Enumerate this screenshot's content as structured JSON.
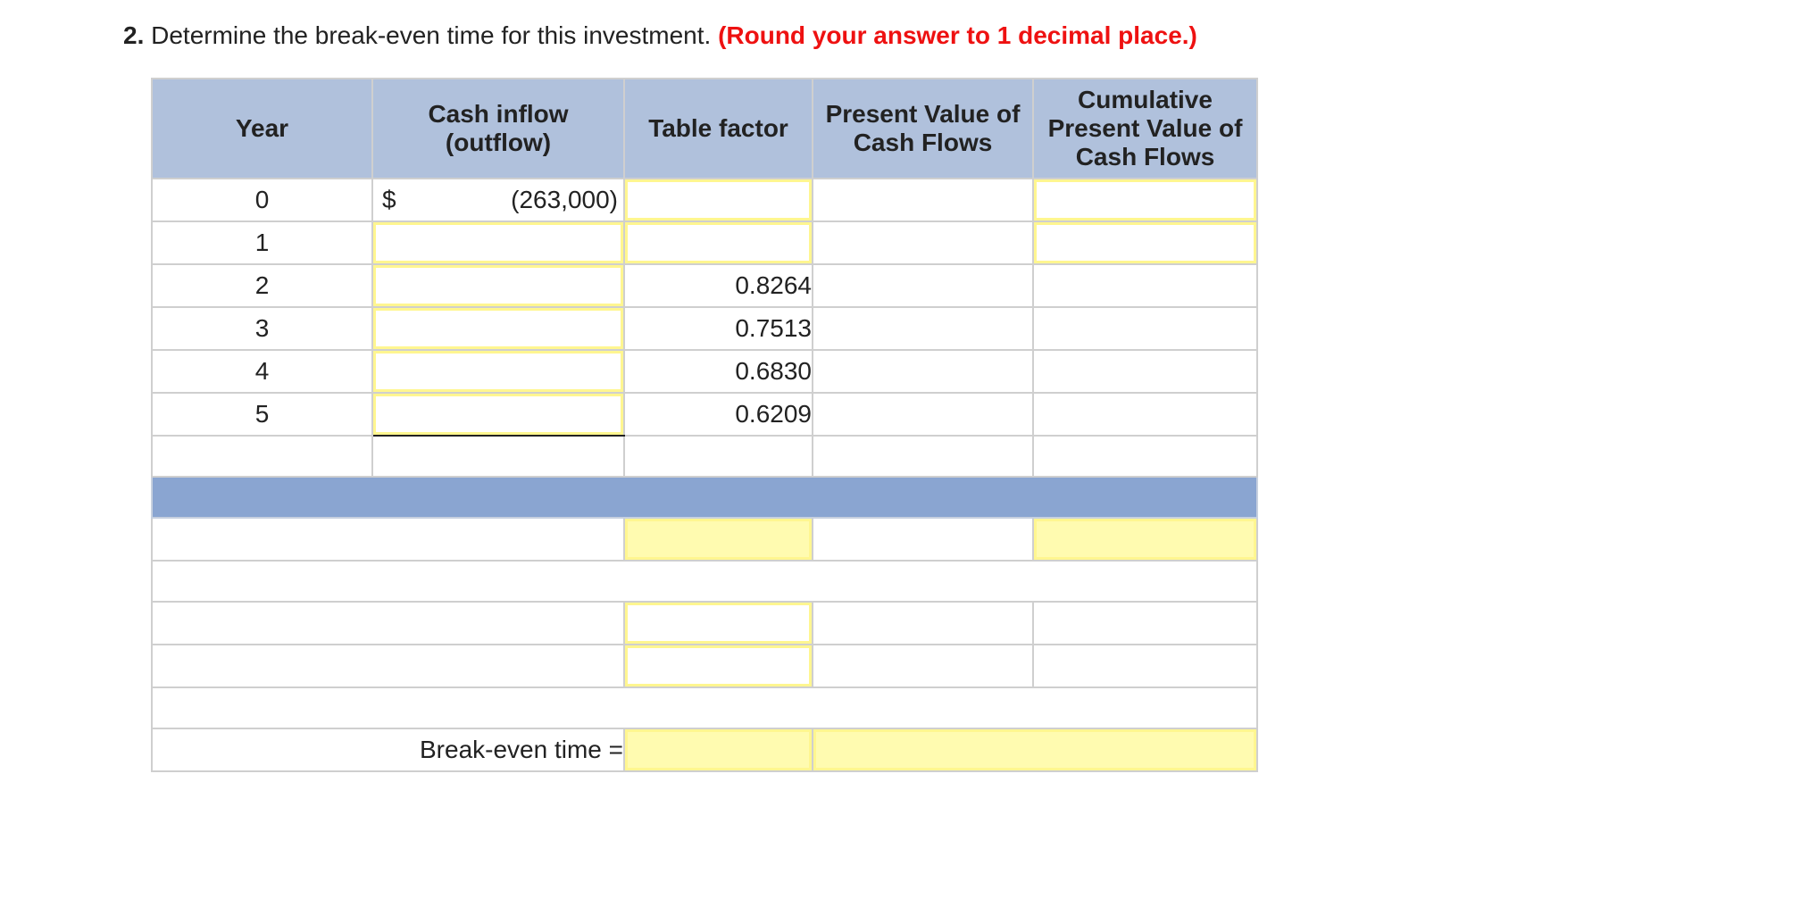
{
  "question": {
    "number": "2.",
    "text": " Determine the break-even time for this investment. ",
    "hint": "(Round your answer to 1 decimal place.)"
  },
  "table": {
    "headers": {
      "year": "Year",
      "cash_flow": "Cash inflow (outflow)",
      "table_factor": "Table factor",
      "pv": "Present Value of Cash Flows",
      "cumulative": "Cumulative Present Value of Cash Flows"
    },
    "rows": [
      {
        "year": "0",
        "currency": "$",
        "cash": "(263,000)",
        "factor": ""
      },
      {
        "year": "1",
        "currency": "",
        "cash": "",
        "factor": ""
      },
      {
        "year": "2",
        "currency": "",
        "cash": "",
        "factor": "0.8264"
      },
      {
        "year": "3",
        "currency": "",
        "cash": "",
        "factor": "0.7513"
      },
      {
        "year": "4",
        "currency": "",
        "cash": "",
        "factor": "0.6830"
      },
      {
        "year": "5",
        "currency": "",
        "cash": "",
        "factor": "0.6209"
      }
    ],
    "break_even_label": "Break-even time ="
  },
  "colors": {
    "header_bg": "#b0c1dc",
    "band_bg": "#8aa5d1",
    "input_border": "#fff690",
    "input_fill": "#fffbb0",
    "hint_red": "#ee1111"
  }
}
